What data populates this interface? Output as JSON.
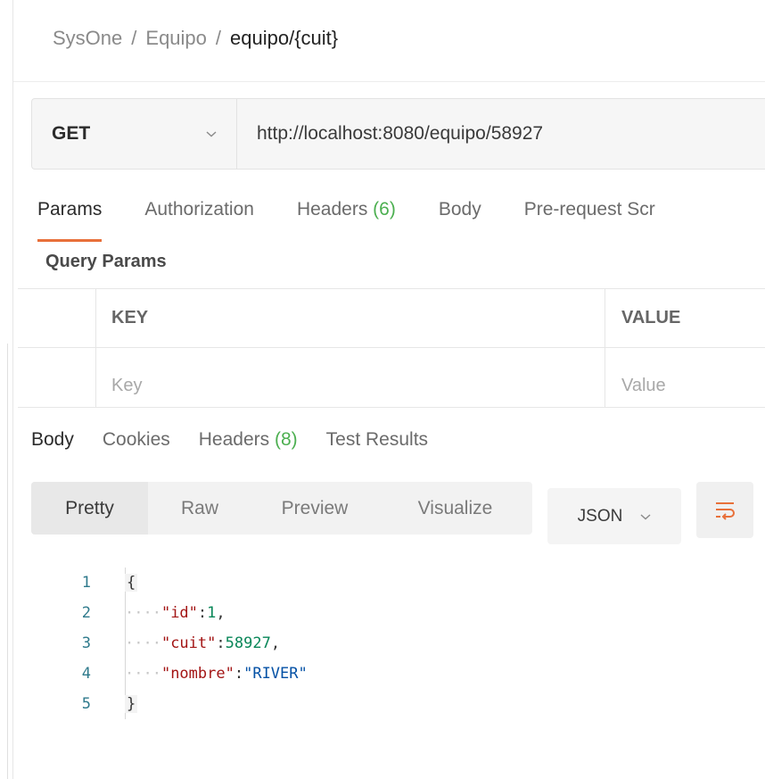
{
  "breadcrumb": {
    "items": [
      "SysOne",
      "Equipo"
    ],
    "separator": "/",
    "current": "equipo/{cuit}"
  },
  "request": {
    "method": "GET",
    "url": "http://localhost:8080/equipo/58927"
  },
  "request_tabs": [
    {
      "label": "Params",
      "count": ""
    },
    {
      "label": "Authorization",
      "count": ""
    },
    {
      "label": "Headers",
      "count": "(6)"
    },
    {
      "label": "Body",
      "count": ""
    },
    {
      "label": "Pre-request Scr",
      "count": ""
    }
  ],
  "query_params": {
    "title": "Query Params",
    "headers": {
      "key": "KEY",
      "value": "VALUE"
    },
    "placeholders": {
      "key": "Key",
      "value": "Value"
    }
  },
  "response_tabs": [
    {
      "label": "Body",
      "count": ""
    },
    {
      "label": "Cookies",
      "count": ""
    },
    {
      "label": "Headers",
      "count": "(8)"
    },
    {
      "label": "Test Results",
      "count": ""
    }
  ],
  "view_modes": [
    "Pretty",
    "Raw",
    "Preview",
    "Visualize"
  ],
  "format": "JSON",
  "code": {
    "line_numbers": [
      "1",
      "2",
      "3",
      "4",
      "5"
    ],
    "lines": [
      {
        "dots": "",
        "key": "",
        "value": "",
        "trailing": "",
        "brace": "{"
      },
      {
        "dots": "····",
        "key": "\"id\"",
        "value": "1",
        "trailing": ",",
        "brace": ""
      },
      {
        "dots": "····",
        "key": "\"cuit\"",
        "value": "58927",
        "trailing": ",",
        "brace": ""
      },
      {
        "dots": "····",
        "key": "\"nombre\"",
        "value": "\"RIVER\"",
        "trailing": "",
        "brace": ""
      },
      {
        "dots": "",
        "key": "",
        "value": "",
        "trailing": "",
        "brace": "}"
      }
    ]
  },
  "colors": {
    "accent": "#e8703a",
    "count_green": "#4caf50",
    "key_red": "#a31515",
    "num_green": "#098658",
    "str_blue": "#0451a5"
  },
  "icons": {
    "method_dropdown": "chevron-down-icon",
    "format_dropdown": "chevron-down-icon",
    "wrap": "wrap-lines-icon"
  }
}
